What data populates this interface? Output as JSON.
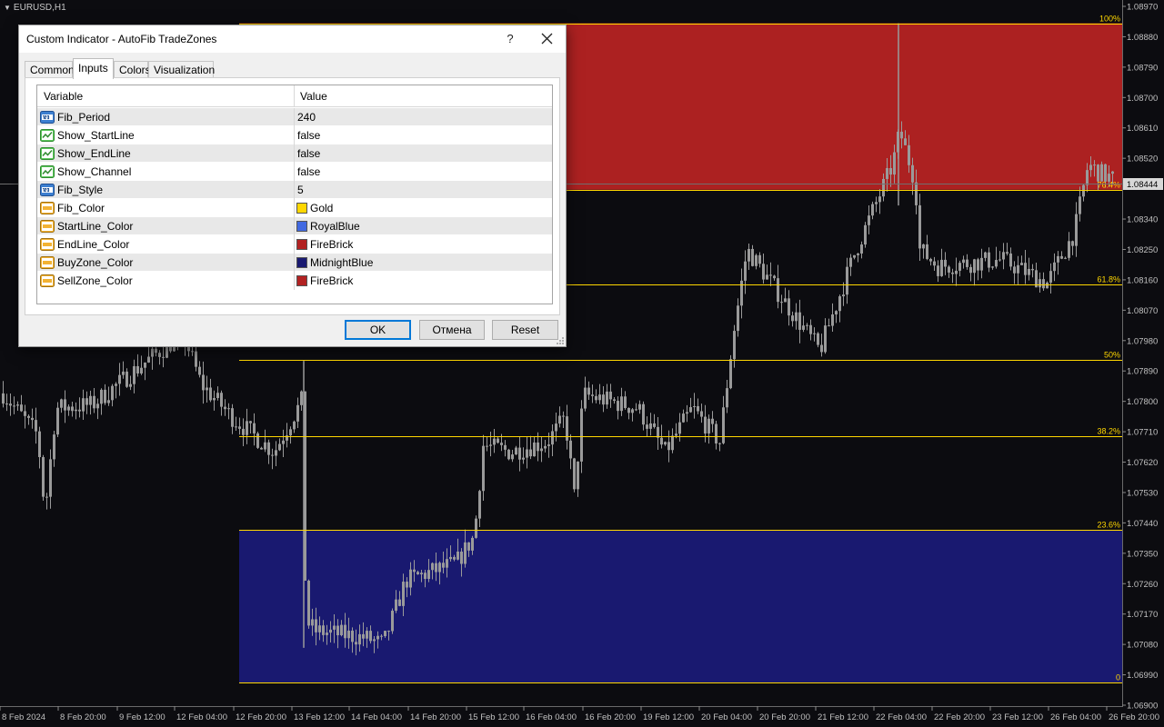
{
  "chart": {
    "symbol": "EURUSD,H1",
    "current_price": "1.08444",
    "colors": {
      "background": "#0c0c10",
      "sell_zone": "#b22222",
      "buy_zone": "#191970",
      "fib_line": "#ffd700",
      "candle": "#9a9a9a"
    },
    "price_axis": [
      "1.08970",
      "1.08880",
      "1.08790",
      "1.08700",
      "1.08610",
      "1.08520",
      "1.08340",
      "1.08250",
      "1.08160",
      "1.08070",
      "1.07980",
      "1.07890",
      "1.07800",
      "1.07710",
      "1.07620",
      "1.07530",
      "1.07440",
      "1.07350",
      "1.07260",
      "1.07170",
      "1.07080",
      "1.06990",
      "1.06900"
    ],
    "time_axis": [
      "8 Feb 2024",
      "8 Feb 20:00",
      "9 Feb 12:00",
      "12 Feb 04:00",
      "12 Feb 20:00",
      "13 Feb 12:00",
      "14 Feb 04:00",
      "14 Feb 20:00",
      "15 Feb 12:00",
      "16 Feb 04:00",
      "16 Feb 20:00",
      "19 Feb 12:00",
      "20 Feb 04:00",
      "20 Feb 20:00",
      "21 Feb 12:00",
      "22 Feb 04:00",
      "22 Feb 20:00",
      "23 Feb 12:00",
      "26 Feb 04:00",
      "26 Feb 20:00"
    ],
    "fib_levels": [
      {
        "label": "100%",
        "price": 1.0892
      },
      {
        "label": "76.4%",
        "price": 1.08427
      },
      {
        "label": "61.8%",
        "price": 1.08147
      },
      {
        "label": "50%",
        "price": 1.07923
      },
      {
        "label": "38.2%",
        "price": 1.07697
      },
      {
        "label": "23.6%",
        "price": 1.07419
      },
      {
        "label": "0",
        "price": 1.06966
      }
    ]
  },
  "dialog": {
    "title": "Custom Indicator - AutoFib TradeZones",
    "help_label": "?",
    "tabs": [
      "Common",
      "Inputs",
      "Colors",
      "Visualization"
    ],
    "active_tab": "Inputs",
    "columns": {
      "variable": "Variable",
      "value": "Value"
    },
    "rows": [
      {
        "name": "Fib_Period",
        "value": "240",
        "type": "int"
      },
      {
        "name": "Show_StartLine",
        "value": "false",
        "type": "bool"
      },
      {
        "name": "Show_EndLine",
        "value": "false",
        "type": "bool"
      },
      {
        "name": "Show_Channel",
        "value": "false",
        "type": "bool"
      },
      {
        "name": "Fib_Style",
        "value": "5",
        "type": "int"
      },
      {
        "name": "Fib_Color",
        "value": "Gold",
        "type": "color",
        "color": "#ffd700"
      },
      {
        "name": "StartLine_Color",
        "value": "RoyalBlue",
        "type": "color",
        "color": "#4169e1"
      },
      {
        "name": "EndLine_Color",
        "value": "FireBrick",
        "type": "color",
        "color": "#b22222"
      },
      {
        "name": "BuyZone_Color",
        "value": "MidnightBlue",
        "type": "color",
        "color": "#191970"
      },
      {
        "name": "SellZone_Color",
        "value": "FireBrick",
        "type": "color",
        "color": "#b22222"
      }
    ],
    "buttons": {
      "ok": "OK",
      "cancel": "Отмена",
      "reset": "Reset"
    }
  }
}
